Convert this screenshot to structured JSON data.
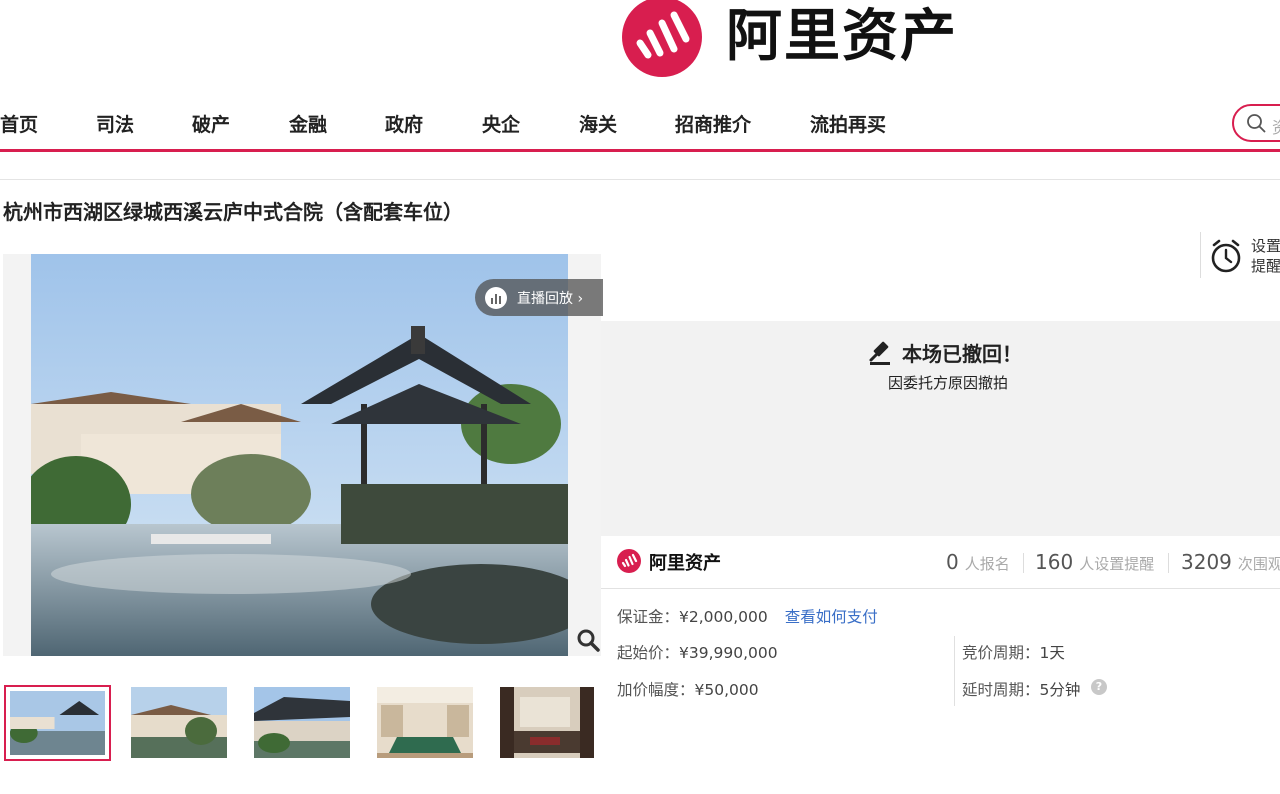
{
  "header": {
    "logo_text": "阿里资产"
  },
  "nav": {
    "items": [
      "首页",
      "司法",
      "破产",
      "金融",
      "政府",
      "央企",
      "海关",
      "招商推介",
      "流拍再买"
    ]
  },
  "search": {
    "placeholder": "资"
  },
  "item": {
    "title": "杭州市西湖区绿城西溪云庐中式合院（含配套车位）"
  },
  "gallery": {
    "replay_label": "直播回放 ›",
    "thumb_count": 5
  },
  "reminder": {
    "label": "设置提醒"
  },
  "status": {
    "headline": "本场已撤回！",
    "reason": "因委托方原因撤拍"
  },
  "brand": {
    "name": "阿里资产"
  },
  "stats": [
    {
      "value": "0",
      "label": "人报名"
    },
    {
      "value": "160",
      "label": "人设置提醒"
    },
    {
      "value": "3209",
      "label": "次围观"
    }
  ],
  "details": {
    "deposit_label": "保证金：",
    "deposit": "¥2,000,000",
    "pay_link": "查看如何支付",
    "start_price_label": "起始价：",
    "start_price": "¥39,990,000",
    "increment_label": "加价幅度：",
    "increment": "¥50,000",
    "period_label": "竞价周期：",
    "period": "1天",
    "delay_label": "延时周期：",
    "delay": "5分钟"
  },
  "colors": {
    "brand_red": "#d81e4f",
    "link_blue": "#3a6fc7"
  }
}
